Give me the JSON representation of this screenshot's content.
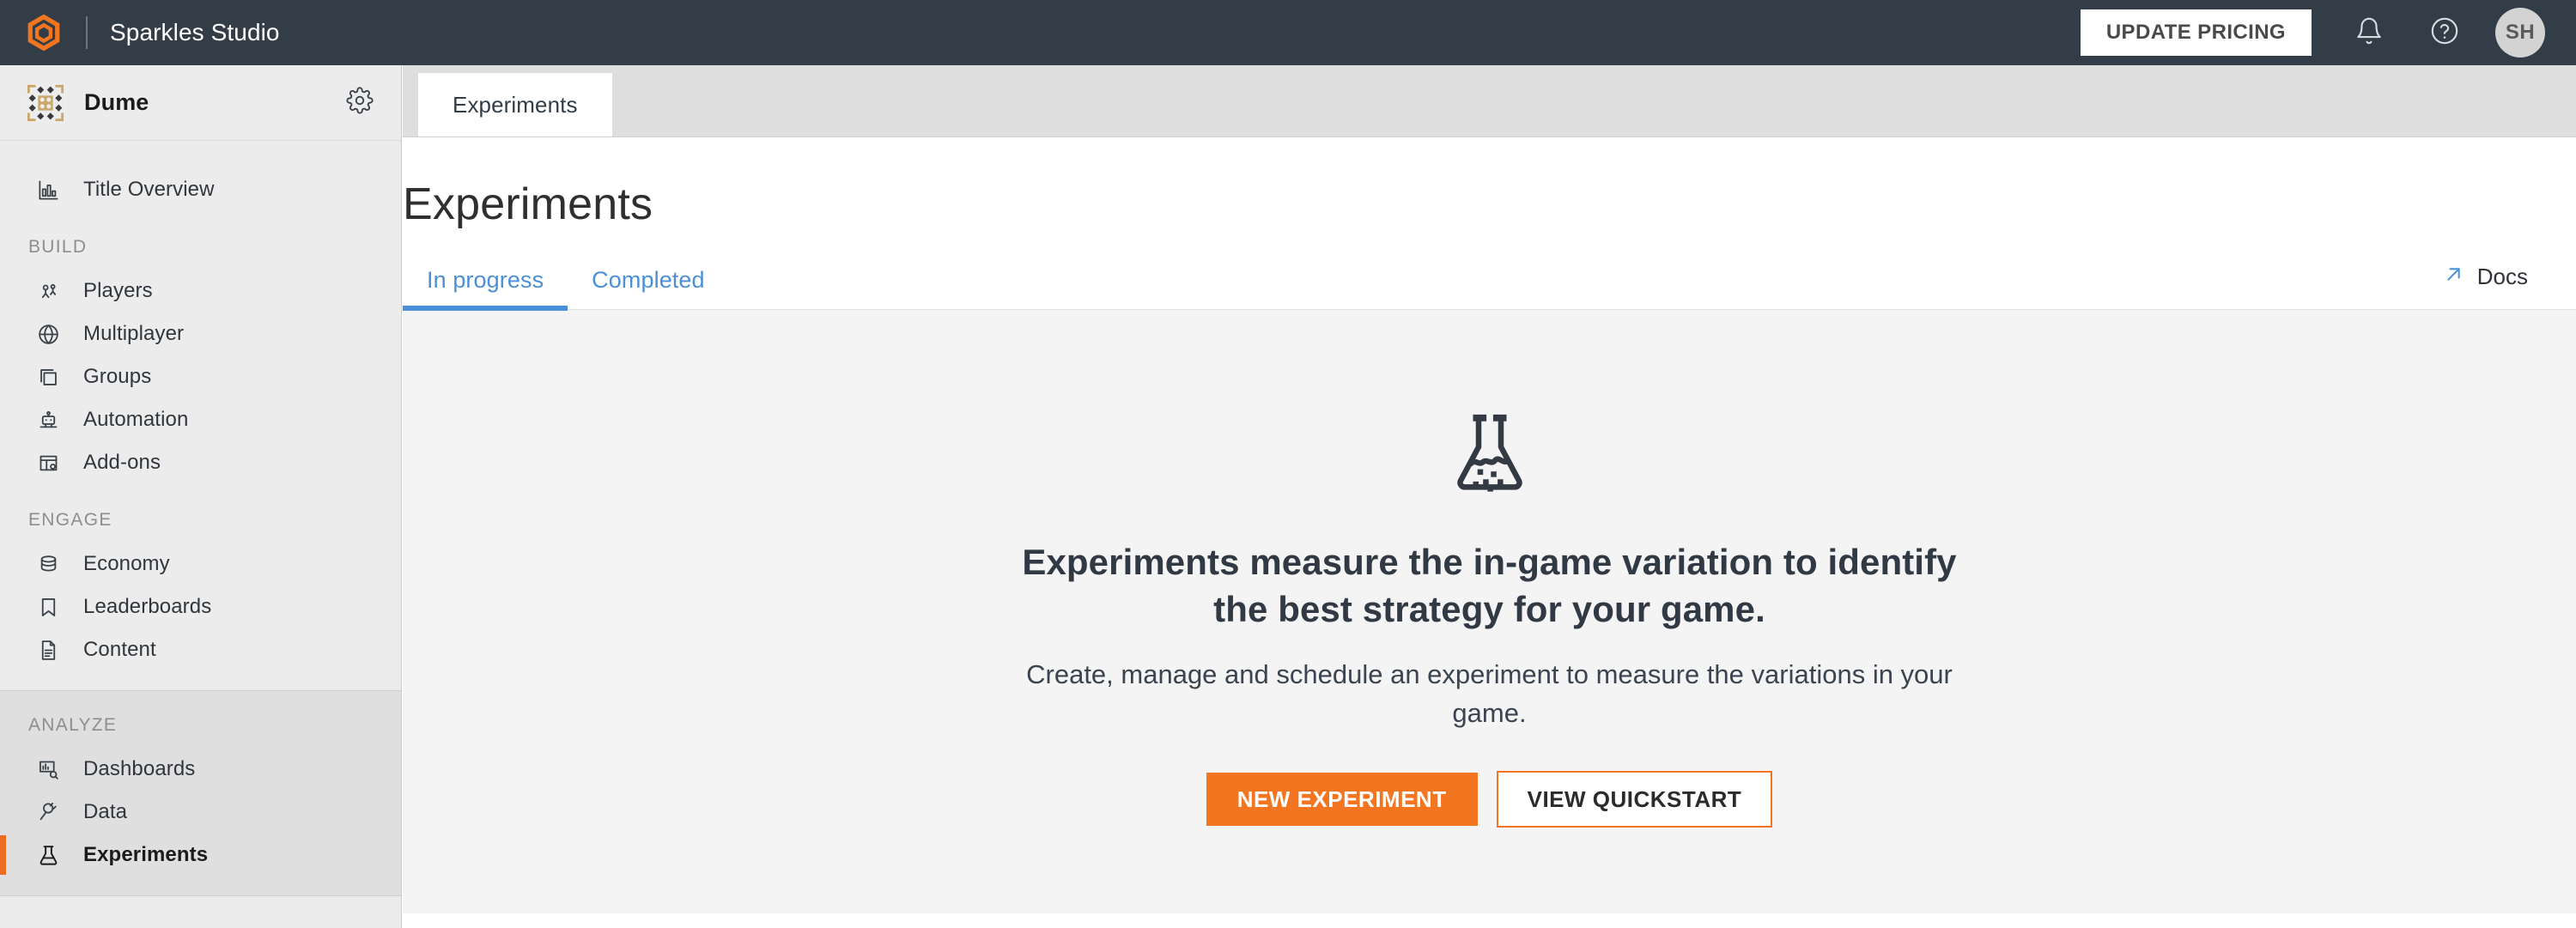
{
  "topbar": {
    "logo_icon": "hexagon-logo-icon",
    "brand_name": "Sparkles Studio",
    "update_pricing_label": "UPDATE PRICING",
    "notifications_icon": "bell-icon",
    "help_icon": "question-circle-icon",
    "avatar_initials": "SH",
    "background_color": "#333d47",
    "accent_color": "#f4751f"
  },
  "sidebar": {
    "title_name": "Dume",
    "title_thumb_icon": "title-thumbnail-icon",
    "settings_icon": "gear-icon",
    "overview": {
      "label": "Title Overview",
      "icon": "bar-chart-icon"
    },
    "sections": [
      {
        "label": "BUILD",
        "items": [
          {
            "label": "Players",
            "icon": "players-icon"
          },
          {
            "label": "Multiplayer",
            "icon": "globe-icon"
          },
          {
            "label": "Groups",
            "icon": "layers-icon"
          },
          {
            "label": "Automation",
            "icon": "robot-icon"
          },
          {
            "label": "Add-ons",
            "icon": "addons-icon"
          }
        ]
      },
      {
        "label": "ENGAGE",
        "items": [
          {
            "label": "Economy",
            "icon": "database-icon"
          },
          {
            "label": "Leaderboards",
            "icon": "bookmark-icon"
          },
          {
            "label": "Content",
            "icon": "document-icon"
          }
        ]
      },
      {
        "label": "ANALYZE",
        "items": [
          {
            "label": "Dashboards",
            "icon": "dashboard-search-icon"
          },
          {
            "label": "Data",
            "icon": "plug-icon"
          },
          {
            "label": "Experiments",
            "icon": "flask-icon"
          }
        ]
      }
    ],
    "active_item": "Experiments",
    "active_indicator_color": "#ef6c23"
  },
  "main": {
    "browser_tab_label": "Experiments",
    "page_title": "Experiments",
    "subtabs": [
      {
        "label": "In progress",
        "active": true
      },
      {
        "label": "Completed",
        "active": false
      }
    ],
    "docs": {
      "label": "Docs",
      "icon": "external-link-arrow-icon"
    },
    "subtab_color": "#4a90d9"
  },
  "empty_state": {
    "illustration_icon": "flask-icon",
    "headline": "Experiments measure the in-game variation to identify the best strategy for your game.",
    "subtext": "Create, manage and schedule an experiment to measure the variations in your game.",
    "primary_button": "NEW EXPERIMENT",
    "secondary_button": "VIEW QUICKSTART"
  }
}
